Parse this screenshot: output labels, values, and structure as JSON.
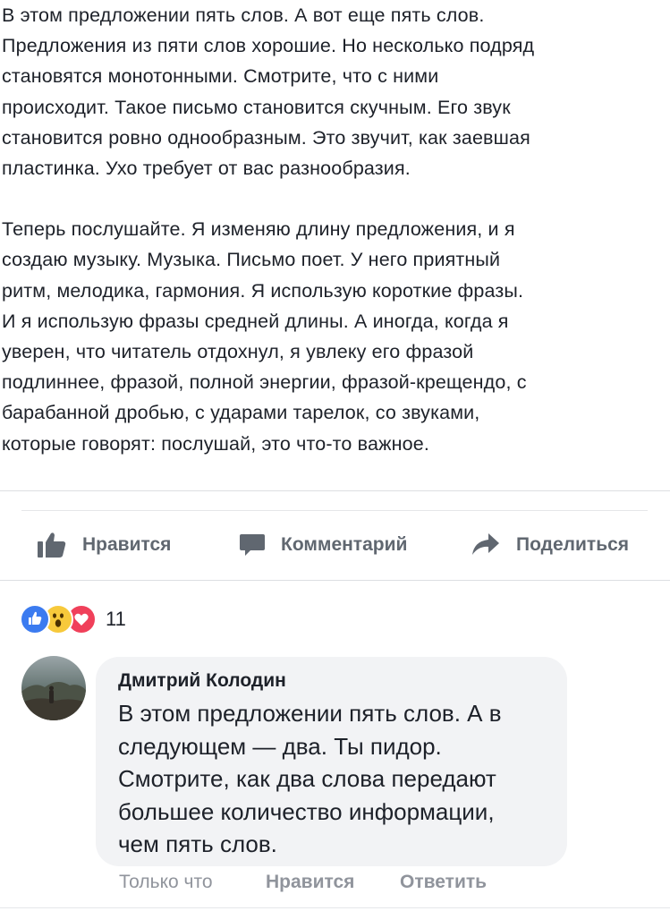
{
  "post": {
    "paragraph_1": "В этом предложении пять слов. А вот еще пять слов.\nПредложения из пяти слов хорошие. Но несколько подряд\nстановятся монотонными. Смотрите, что с ними\nпроисходит. Такое письмо становится скучным. Его звук\nстановится ровно однообразным. Это звучит, как заевшая\nпластинка. Ухо требует от вас разнообразия.",
    "paragraph_2": "Теперь послушайте. Я изменяю длину предложения, и я\nсоздаю музыку. Музыка. Письмо поет. У него приятный\nритм, мелодика, гармония. Я использую короткие фразы.\nИ я использую фразы средней длины. А иногда, когда я\nуверен, что читатель отдохнул, я увлеку его фразой\nподлиннее, фразой, полной энергии, фразой-крещендо, с\nбарабанной дробью, с ударами тарелок, со звуками,\nкоторые говорят: послушай, это что-то важное."
  },
  "actions": {
    "like_label": "Нравится",
    "comment_label": "Комментарий",
    "share_label": "Поделиться",
    "icon_color": "#606770"
  },
  "reactions": {
    "icons": [
      "like-icon",
      "wow-icon",
      "love-icon"
    ],
    "count": "11"
  },
  "comment": {
    "author": "Дмитрий Колодин",
    "text": "В этом предложении пять слов. А в\nследующем — два. Ты пидор.\nСмотрите, как два слова передают\nбольшее количество информации,\nчем пять слов.",
    "time": "Только что",
    "like_label": "Нравится",
    "reply_label": "Ответить"
  }
}
